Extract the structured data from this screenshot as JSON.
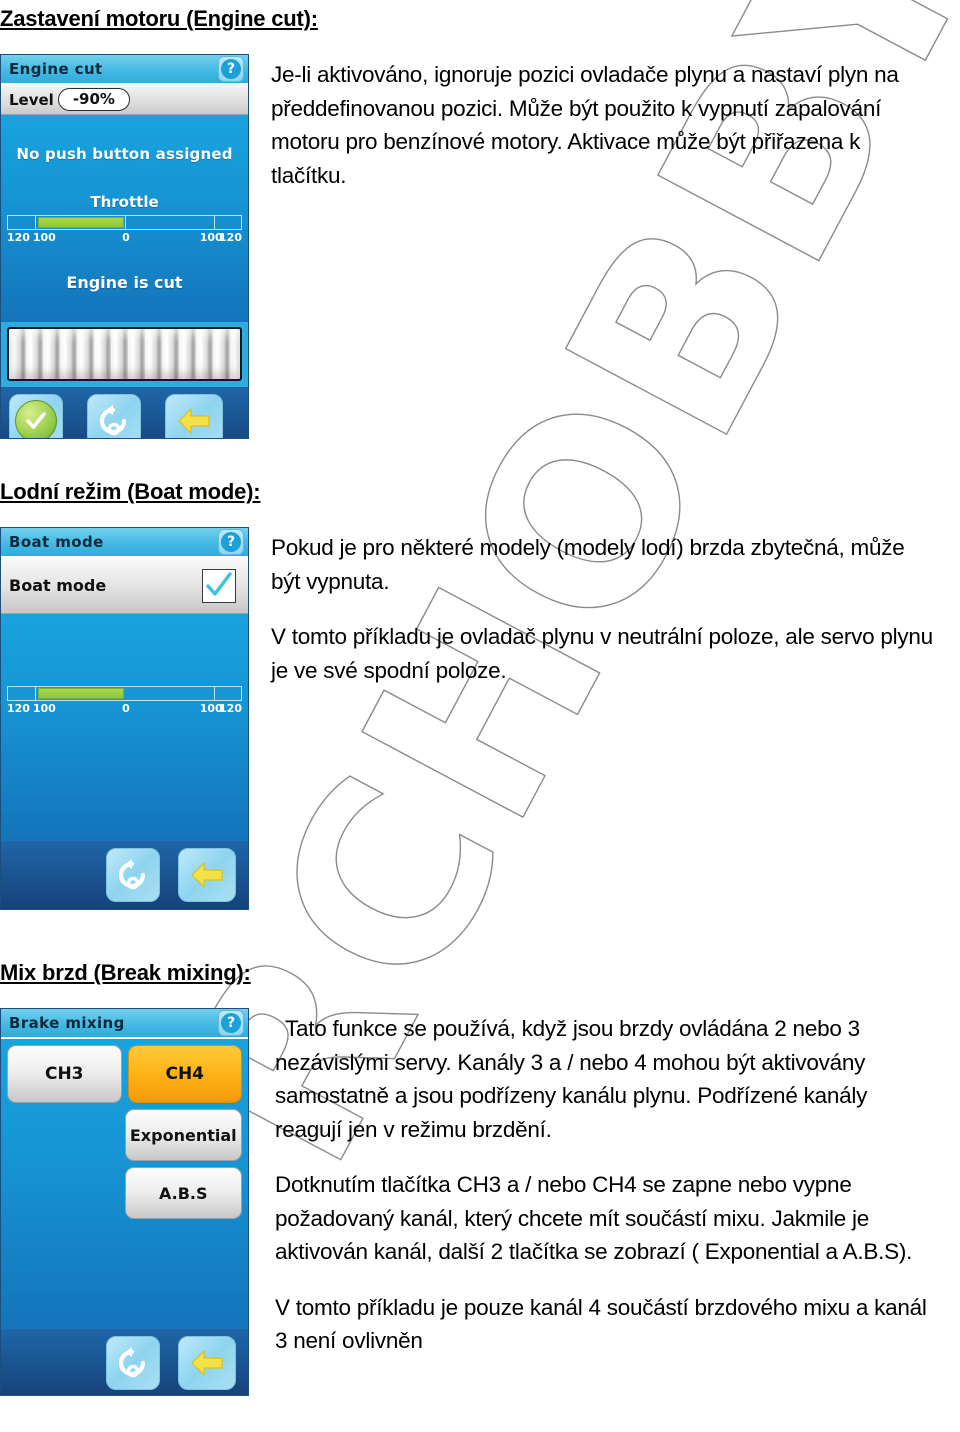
{
  "watermark": {
    "text": "RCHOBBY"
  },
  "sections": [
    {
      "heading": "Zastavení motoru (Engine cut):",
      "paragraphs": [
        "Je-li aktivováno, ignoruje pozici ovladače plynu a nastaví plyn na předdefinovanou pozici. Může být použito k vypnutí zapalování motoru pro benzínové motory. Aktivace může být přiřazena k tlačítku."
      ],
      "device": {
        "title": "Engine cut",
        "help_icon": "question-mark-icon",
        "level_label": "Level",
        "level_value": "-90%",
        "status_top": "No push button assigned",
        "throttle_label": "Throttle",
        "status_bottom": "Engine is cut",
        "scale": [
          "120",
          "100",
          "0",
          "100",
          "120"
        ],
        "buttons": [
          "confirm-icon",
          "reset-icon",
          "back-icon"
        ]
      }
    },
    {
      "heading": "Lodní režim (Boat mode):",
      "paragraphs": [
        "Pokud je pro některé modely (modely lodí) brzda zbytečná, může být vypnuta.",
        "V tomto příkladu je ovladač plynu v neutrální poloze, ale servo plynu je ve své spodní poloze."
      ],
      "device": {
        "title": "Boat mode",
        "help_icon": "question-mark-icon",
        "check_label": "Boat mode",
        "check_state": "checked",
        "scale": [
          "120",
          "100",
          "0",
          "100",
          "120"
        ],
        "buttons": [
          "reset-icon",
          "back-icon"
        ]
      }
    },
    {
      "heading": "Mix brzd (Break mixing):",
      "paragraphs": [
        "Tato funkce se používá, když jsou brzdy ovládána 2 nebo 3 nezávislými servy. Kanály 3 a / nebo 4 mohou být aktivovány samostatně a jsou podřízeny kanálu plynu. Podřízené kanály reagují jen v režimu brzdění.",
        "Dotknutím tlačítka CH3 a / nebo CH4 se zapne nebo vypne požadovaný kanál, který chcete mít součástí mixu. Jakmile je aktivován kanál, další 2 tlačítka se zobrazí ( Exponential a A.B.S).",
        "V tomto příkladu je pouze kanál 4 součástí brzdového mixu a kanál 3 není ovlivněn"
      ],
      "device": {
        "title": "Brake mixing",
        "help_icon": "question-mark-icon",
        "channel_buttons": [
          {
            "label": "CH3",
            "state": "off"
          },
          {
            "label": "CH4",
            "state": "on"
          }
        ],
        "sub_buttons": [
          "Exponential",
          "A.B.S"
        ],
        "buttons": [
          "reset-icon",
          "back-icon"
        ]
      }
    }
  ],
  "colors": {
    "device_header": "#46b9e4",
    "device_body": "#1695d4",
    "bar_green": "#8cc63f",
    "active_orange": "#fcb316",
    "footer_blue": "#1b5694"
  }
}
